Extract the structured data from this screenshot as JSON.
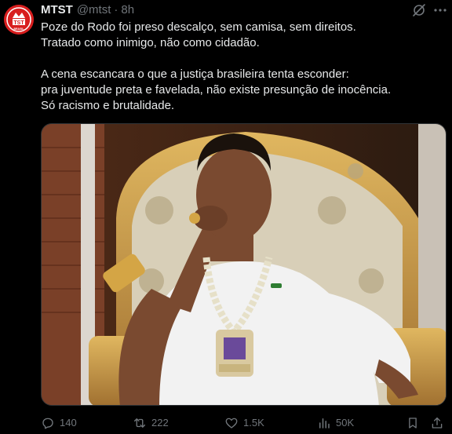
{
  "post": {
    "author_name": "MTST",
    "handle": "@mtst",
    "separator": "·",
    "time": "8h",
    "avatar_text": "TST",
    "avatar_subtext": "BRASIL",
    "lines": [
      "Poze do Rodo foi preso descalço, sem camisa, sem direitos.",
      "Tratado como inimigo, não como cidadão.",
      "A cena escancara o que a justiça brasileira tenta esconder:",
      "pra juventude preta e favelada, não existe presunção de inocência.",
      "Só racismo e brutalidade."
    ]
  },
  "stats": {
    "replies": "140",
    "reposts": "222",
    "likes": "1.5K",
    "views": "50K"
  },
  "icons": {
    "avatar": "mtst-logo",
    "grok": "grok-icon",
    "more": "more-icon",
    "reply": "reply-icon",
    "repost": "repost-icon",
    "like": "heart-icon",
    "views": "views-chart-icon",
    "share": "share-icon"
  },
  "colors": {
    "background": "#000000",
    "text": "#e7e9ea",
    "secondary": "#71767b",
    "avatar_red": "#d81e1e"
  }
}
